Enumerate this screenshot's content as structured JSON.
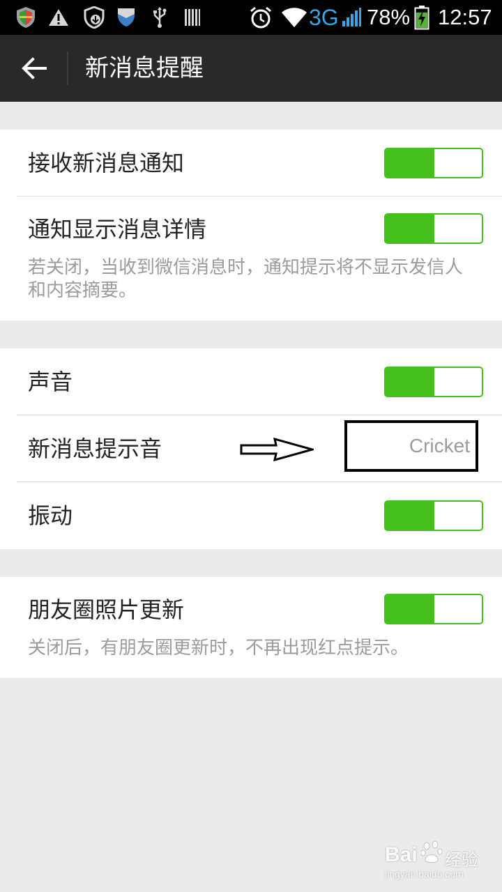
{
  "status_bar": {
    "network": "3G",
    "battery": "78%",
    "time": "12:57",
    "icons": [
      "shield-icon",
      "warning-icon",
      "download-shield-icon",
      "bookmark-shield-icon",
      "usb-icon",
      "barcode-icon",
      "alarm-icon",
      "wifi-icon",
      "signal-icon",
      "battery-charging-icon"
    ]
  },
  "header": {
    "title": "新消息提醒",
    "back_icon": "arrow-left-icon"
  },
  "sections": [
    {
      "rows": [
        {
          "label": "接收新消息通知",
          "toggle": true
        },
        {
          "label": "通知显示消息详情",
          "toggle": true,
          "subtitle": "若关闭，当收到微信消息时，通知提示将不显示发信人和内容摘要。"
        }
      ]
    },
    {
      "rows": [
        {
          "label": "声音",
          "toggle": true
        },
        {
          "label": "新消息提示音",
          "value": "Cricket"
        },
        {
          "label": "振动",
          "toggle": true
        }
      ]
    },
    {
      "rows": [
        {
          "label": "朋友圈照片更新",
          "toggle": true,
          "subtitle": "关闭后，有朋友圈更新时，不再出现红点提示。"
        }
      ]
    }
  ],
  "colors": {
    "accent_green": "#44c01c",
    "action_bar": "#27292b",
    "background": "#ebebeb",
    "network_blue": "#35a7e6"
  },
  "watermark": {
    "brand": "Bai",
    "brand_suffix": "经验",
    "url": "jingyan.baidu.com"
  }
}
